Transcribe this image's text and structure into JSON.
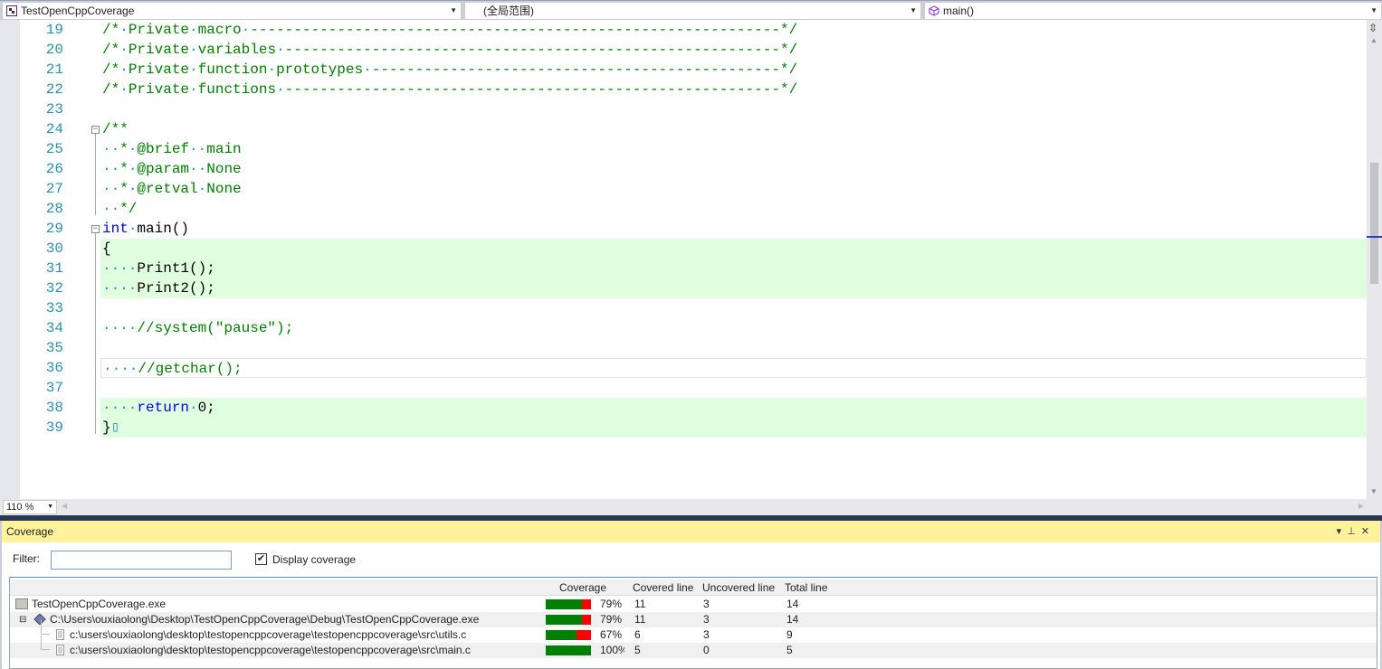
{
  "navbar": {
    "project": "TestOpenCppCoverage",
    "scope": "(全局范围)",
    "function": "main()"
  },
  "editor": {
    "zoom": "110 %",
    "lines": [
      {
        "num": "19",
        "covered": false,
        "tokens": [
          [
            "c",
            "/*"
          ],
          [
            "d",
            "·"
          ],
          [
            "c",
            "Private"
          ],
          [
            "d",
            "·"
          ],
          [
            "c",
            "macro"
          ],
          [
            "d",
            "·"
          ],
          [
            "c",
            "-------------------------------------------------------------*/"
          ]
        ]
      },
      {
        "num": "20",
        "covered": false,
        "tokens": [
          [
            "c",
            "/*"
          ],
          [
            "d",
            "·"
          ],
          [
            "c",
            "Private"
          ],
          [
            "d",
            "·"
          ],
          [
            "c",
            "variables"
          ],
          [
            "d",
            "·"
          ],
          [
            "c",
            "---------------------------------------------------------*/"
          ]
        ]
      },
      {
        "num": "21",
        "covered": false,
        "tokens": [
          [
            "c",
            "/*"
          ],
          [
            "d",
            "·"
          ],
          [
            "c",
            "Private"
          ],
          [
            "d",
            "·"
          ],
          [
            "c",
            "function"
          ],
          [
            "d",
            "·"
          ],
          [
            "c",
            "prototypes"
          ],
          [
            "d",
            "·"
          ],
          [
            "c",
            "-----------------------------------------------*/"
          ]
        ]
      },
      {
        "num": "22",
        "covered": false,
        "tokens": [
          [
            "c",
            "/*"
          ],
          [
            "d",
            "·"
          ],
          [
            "c",
            "Private"
          ],
          [
            "d",
            "·"
          ],
          [
            "c",
            "functions"
          ],
          [
            "d",
            "·"
          ],
          [
            "c",
            "---------------------------------------------------------*/"
          ]
        ]
      },
      {
        "num": "23",
        "covered": false,
        "tokens": []
      },
      {
        "num": "24",
        "covered": false,
        "fold": true,
        "tokens": [
          [
            "c",
            "/**"
          ]
        ]
      },
      {
        "num": "25",
        "covered": false,
        "tokens": [
          [
            "d",
            "··"
          ],
          [
            "c",
            "*"
          ],
          [
            "d",
            "·"
          ],
          [
            "c",
            "@brief"
          ],
          [
            "d",
            "··"
          ],
          [
            "c",
            "main"
          ]
        ]
      },
      {
        "num": "26",
        "covered": false,
        "tokens": [
          [
            "d",
            "··"
          ],
          [
            "c",
            "*"
          ],
          [
            "d",
            "·"
          ],
          [
            "c",
            "@param"
          ],
          [
            "d",
            "··"
          ],
          [
            "c",
            "None"
          ]
        ]
      },
      {
        "num": "27",
        "covered": false,
        "tokens": [
          [
            "d",
            "··"
          ],
          [
            "c",
            "*"
          ],
          [
            "d",
            "·"
          ],
          [
            "c",
            "@retval"
          ],
          [
            "d",
            "·"
          ],
          [
            "c",
            "None"
          ]
        ]
      },
      {
        "num": "28",
        "covered": false,
        "tokens": [
          [
            "d",
            "··"
          ],
          [
            "c",
            "*/"
          ]
        ]
      },
      {
        "num": "29",
        "covered": false,
        "fold": true,
        "tokens": [
          [
            "k",
            "int"
          ],
          [
            "d",
            "·"
          ],
          [
            "p",
            "main()"
          ]
        ]
      },
      {
        "num": "30",
        "covered": true,
        "tokens": [
          [
            "p",
            "{"
          ]
        ]
      },
      {
        "num": "31",
        "covered": true,
        "tokens": [
          [
            "d",
            "····"
          ],
          [
            "p",
            "Print1();"
          ]
        ]
      },
      {
        "num": "32",
        "covered": true,
        "tokens": [
          [
            "d",
            "····"
          ],
          [
            "p",
            "Print2();"
          ]
        ]
      },
      {
        "num": "33",
        "covered": false,
        "tokens": []
      },
      {
        "num": "34",
        "covered": false,
        "tokens": [
          [
            "d",
            "····"
          ],
          [
            "c",
            "//system(\"pause\");"
          ]
        ]
      },
      {
        "num": "35",
        "covered": false,
        "tokens": []
      },
      {
        "num": "36",
        "covered": false,
        "current": true,
        "tokens": [
          [
            "d",
            "····"
          ],
          [
            "c",
            "//getchar();"
          ]
        ]
      },
      {
        "num": "37",
        "covered": false,
        "tokens": []
      },
      {
        "num": "38",
        "covered": true,
        "tokens": [
          [
            "d",
            "····"
          ],
          [
            "k",
            "return"
          ],
          [
            "d",
            "·"
          ],
          [
            "p",
            "0;"
          ]
        ]
      },
      {
        "num": "39",
        "covered": true,
        "tokens": [
          [
            "p",
            "}"
          ],
          [
            "d",
            "▯"
          ]
        ]
      }
    ]
  },
  "coverage_panel": {
    "title": "Coverage",
    "filter_label": "Filter:",
    "filter_value": "",
    "display_coverage_label": "Display coverage",
    "display_coverage_checked": true,
    "columns": [
      "Coverage",
      "Covered line",
      "Uncovered line",
      "Total line"
    ],
    "colors": {
      "covered": "#008000",
      "uncovered": "#ff0000"
    },
    "rows": [
      {
        "name": "TestOpenCppCoverage.exe",
        "icon": "folder-icon",
        "level": 0,
        "percent": 79,
        "percent_label": "79%",
        "covered": "11",
        "uncovered": "3",
        "total": "14"
      },
      {
        "name": "C:\\Users\\ouxiaolong\\Desktop\\TestOpenCppCoverage\\Debug\\TestOpenCppCoverage.exe",
        "icon": "module-icon",
        "level": 1,
        "expanded": true,
        "percent": 79,
        "percent_label": "79%",
        "covered": "11",
        "uncovered": "3",
        "total": "14"
      },
      {
        "name": "c:\\users\\ouxiaolong\\desktop\\testopencppcoverage\\testopencppcoverage\\src\\utils.c",
        "icon": "file-icon",
        "level": 2,
        "percent": 67,
        "percent_label": "67%",
        "covered": "6",
        "uncovered": "3",
        "total": "9"
      },
      {
        "name": "c:\\users\\ouxiaolong\\desktop\\testopencppcoverage\\testopencppcoverage\\src\\main.c",
        "icon": "file-icon",
        "level": 2,
        "percent": 100,
        "percent_label": "100%",
        "covered": "5",
        "uncovered": "0",
        "total": "5"
      }
    ]
  }
}
